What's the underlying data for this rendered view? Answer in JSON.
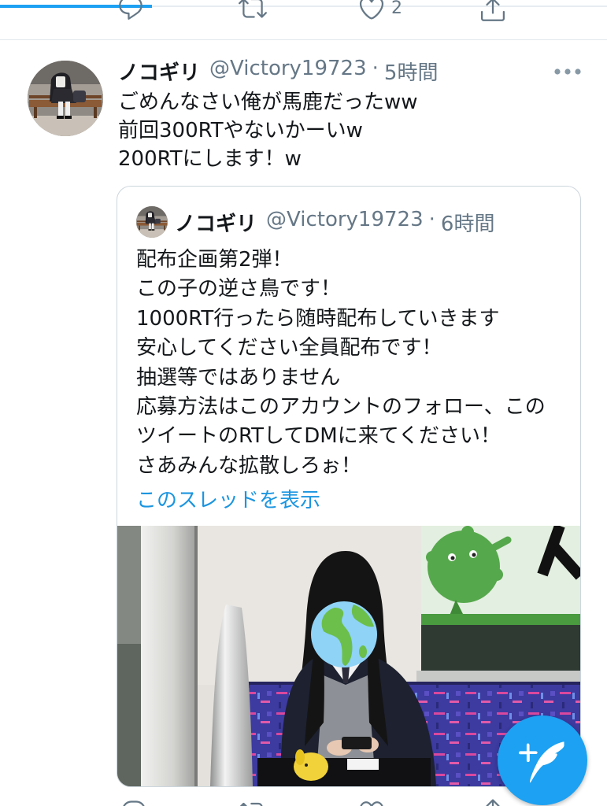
{
  "colors": {
    "accent": "#1da1f2",
    "text": "#14171a",
    "secondary": "#657786",
    "border": "#ccd6dd",
    "link": "#1b95e0"
  },
  "progress": {
    "fraction": 0.25
  },
  "previous_tweet_actions": {
    "reply_icon": "reply-icon",
    "retweet_icon": "retweet-icon",
    "like_icon": "heart-icon",
    "like_count": "2",
    "share_icon": "share-icon"
  },
  "tweet": {
    "author_name": "ノコギリ",
    "handle": "@Victory19723",
    "separator": "·",
    "time": "5時間",
    "more_icon": "more-icon",
    "lines": [
      "ごめんなさい俺が馬鹿だったww",
      "前回300RTやないかーいw",
      "200RTにします！w"
    ],
    "quoted_tweet": {
      "author_name": "ノコギリ",
      "handle": "@Victory19723",
      "separator": "·",
      "time": "6時間",
      "lines": [
        "配布企画第2弾！",
        "この子の逆さ鳥です！",
        "1000RT行ったら随時配布していきます",
        "安心してください全員配布です！",
        "抽選等ではありません",
        "応募方法はこのアカウントのフォロー、この",
        "ツイートのRTしてDMに来てください！",
        "さあみんな拡散しろぉ！"
      ],
      "show_thread_link": "このスレッドを表示"
    }
  },
  "next_tweet_actions": {
    "reply_icon": "reply-icon",
    "retweet_icon": "retweet-icon",
    "like_icon": "heart-icon",
    "share_icon": "share-icon"
  },
  "compose_button": {
    "icon": "compose-tweet-icon"
  }
}
